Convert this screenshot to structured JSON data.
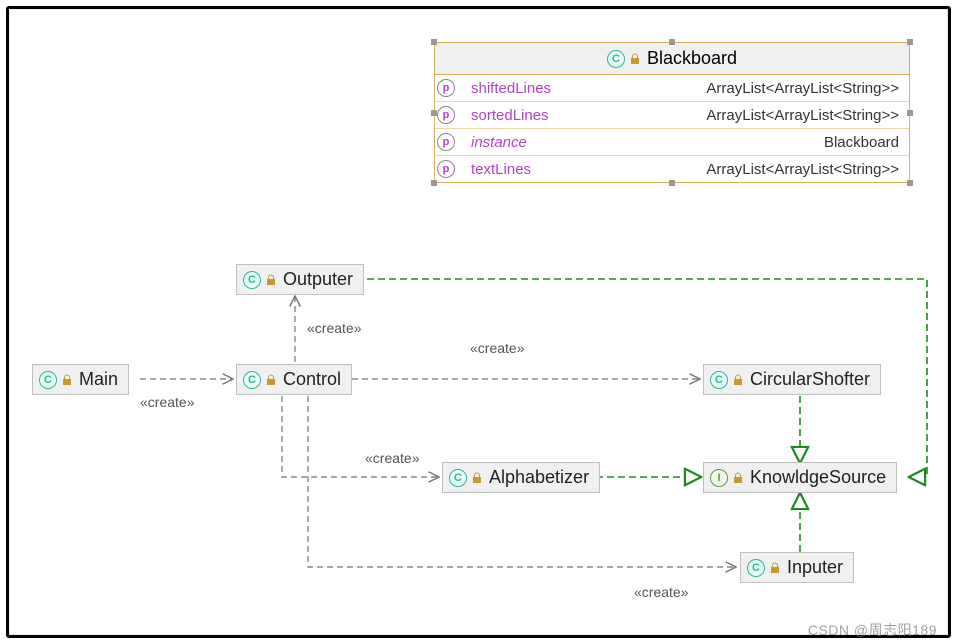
{
  "classBox": {
    "title": "Blackboard",
    "iconLetter": "C",
    "attributes": [
      {
        "name": "shiftedLines",
        "type": "ArrayList<ArrayList<String>>",
        "vis": "p",
        "italic": false
      },
      {
        "name": "sortedLines",
        "type": "ArrayList<ArrayList<String>>",
        "vis": "p",
        "italic": false
      },
      {
        "name": "instance",
        "type": "Blackboard",
        "vis": "p",
        "italic": true
      },
      {
        "name": "textLines",
        "type": "ArrayList<ArrayList<String>>",
        "vis": "p",
        "italic": false
      }
    ]
  },
  "nodes": {
    "main": {
      "label": "Main",
      "iconLetter": "C"
    },
    "control": {
      "label": "Control",
      "iconLetter": "C"
    },
    "outputer": {
      "label": "Outputer",
      "iconLetter": "C"
    },
    "alphabetizer": {
      "label": "Alphabetizer",
      "iconLetter": "C"
    },
    "circularShofter": {
      "label": "CircularShofter",
      "iconLetter": "C"
    },
    "inputer": {
      "label": "Inputer",
      "iconLetter": "C"
    },
    "knowledgeSource": {
      "label": "KnowldgeSource",
      "iconLetter": "I"
    }
  },
  "stereotype": "«create»",
  "watermark": "CSDN @周志阳189"
}
